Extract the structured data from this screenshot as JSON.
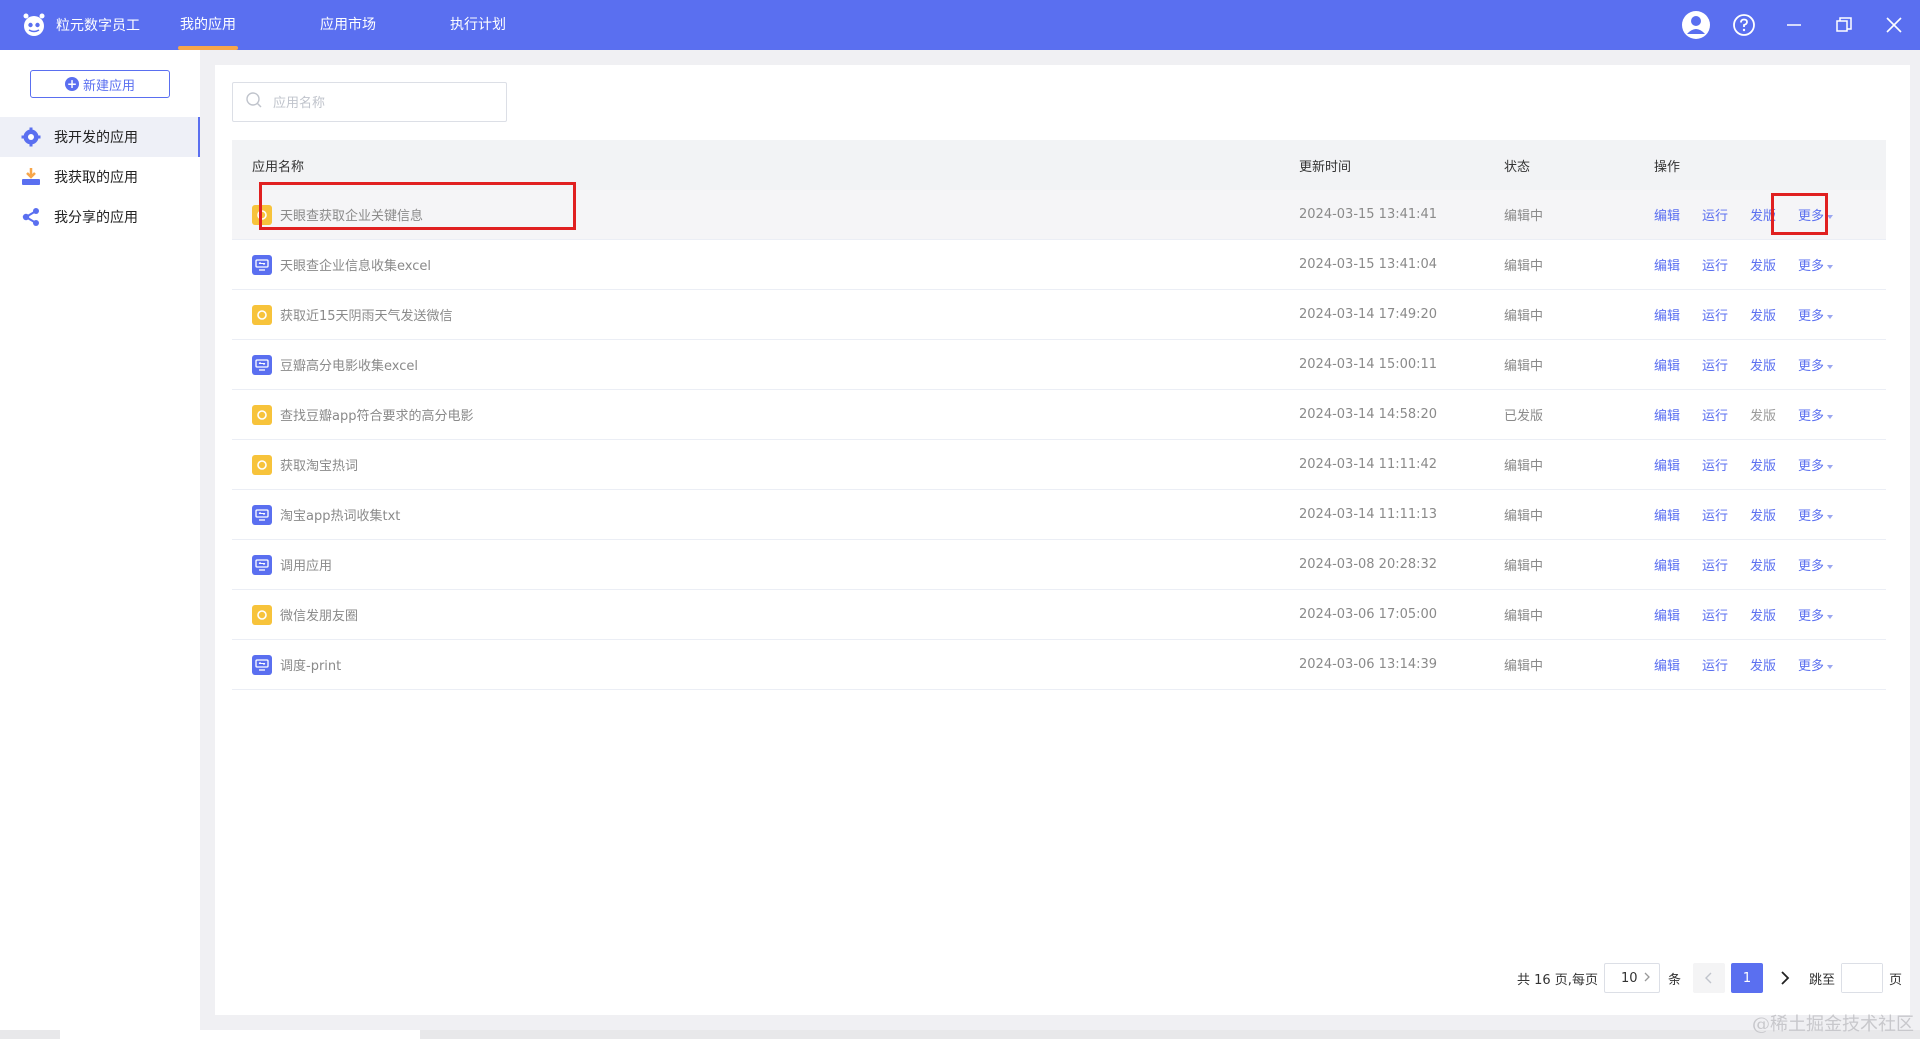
{
  "header": {
    "brand": "粒元数字员工",
    "tabs": [
      {
        "label": "我的应用",
        "active": true
      },
      {
        "label": "应用市场",
        "active": false
      },
      {
        "label": "执行计划",
        "active": false
      }
    ],
    "icons": [
      "user-icon",
      "help-icon",
      "minimize-icon",
      "restore-icon",
      "close-icon"
    ]
  },
  "sidebar": {
    "new_app_label": "新建应用",
    "items": [
      {
        "label": "我开发的应用",
        "icon": "gear-icon",
        "active": true
      },
      {
        "label": "我获取的应用",
        "icon": "download-tray-icon",
        "active": false
      },
      {
        "label": "我分享的应用",
        "icon": "share-icon",
        "active": false
      }
    ]
  },
  "search": {
    "placeholder": "应用名称",
    "value": ""
  },
  "table": {
    "columns": [
      "应用名称",
      "更新时间",
      "状态",
      "操作"
    ],
    "ops": {
      "edit": "编辑",
      "run": "运行",
      "publish": "发版",
      "more": "更多"
    },
    "rows": [
      {
        "name": "天眼查获取企业关键信息",
        "icon": "yellow",
        "time": "2024-03-15 13:41:41",
        "status": "编辑中"
      },
      {
        "name": "天眼查企业信息收集excel",
        "icon": "blue",
        "time": "2024-03-15 13:41:04",
        "status": "编辑中"
      },
      {
        "name": "获取近15天阴雨天气发送微信",
        "icon": "yellow",
        "time": "2024-03-14 17:49:20",
        "status": "编辑中"
      },
      {
        "name": "豆瓣高分电影收集excel",
        "icon": "blue",
        "time": "2024-03-14 15:00:11",
        "status": "编辑中"
      },
      {
        "name": "查找豆瓣app符合要求的高分电影",
        "icon": "yellow",
        "time": "2024-03-14 14:58:20",
        "status": "已发版"
      },
      {
        "name": "获取淘宝热词",
        "icon": "yellow",
        "time": "2024-03-14 11:11:42",
        "status": "编辑中"
      },
      {
        "name": "淘宝app热词收集txt",
        "icon": "blue",
        "time": "2024-03-14 11:11:13",
        "status": "编辑中"
      },
      {
        "name": "调用应用",
        "icon": "blue",
        "time": "2024-03-08 20:28:32",
        "status": "编辑中"
      },
      {
        "name": "微信发朋友圈",
        "icon": "yellow",
        "time": "2024-03-06 17:05:00",
        "status": "编辑中"
      },
      {
        "name": "调度-print",
        "icon": "blue",
        "time": "2024-03-06 13:14:39",
        "status": "编辑中"
      }
    ]
  },
  "pagination": {
    "total_prefix": "共 16 页,每页",
    "page_size": "10",
    "unit": "条",
    "current_page": "1",
    "jump_label": "跳至",
    "jump_suffix": "页"
  },
  "watermark": "@稀土掘金技术社区",
  "colors": {
    "primary": "#5a6ff0",
    "tab_indicator": "#f7a64a",
    "highlight": "#e02020",
    "icon_yellow": "#f7c33b"
  }
}
